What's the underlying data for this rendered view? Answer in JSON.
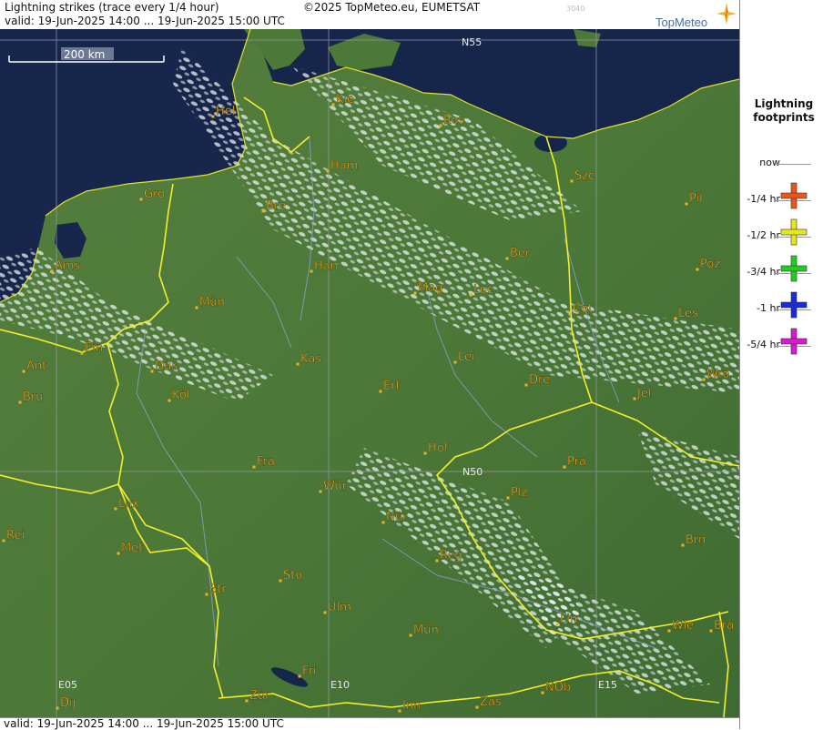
{
  "header": {
    "title": "Lightning strikes (trace every 1/4 hour)",
    "valid": "valid:  19-Jun-2025 14:00 ... 19-Jun-2025 15:00 UTC",
    "copyright": "©2025 TopMeteo.eu, EUMETSAT",
    "code": "3040",
    "logo": "TopMeteo"
  },
  "footer": {
    "valid": "valid:  19-Jun-2025 14:00 ... 19-Jun-2025 15:00 UTC"
  },
  "scale": {
    "label": "200 km"
  },
  "grid_labels": {
    "n55": "N55",
    "n50": "N50",
    "e05": "E05",
    "e10": "E10",
    "e15": "E15"
  },
  "cities": [
    {
      "name": "Hel"
    },
    {
      "name": "Kie"
    },
    {
      "name": "Ros"
    },
    {
      "name": "Ham"
    },
    {
      "name": "Szc"
    },
    {
      "name": "Gro"
    },
    {
      "name": "Bre"
    },
    {
      "name": "Pil"
    },
    {
      "name": "Ber"
    },
    {
      "name": "Ams"
    },
    {
      "name": "Han"
    },
    {
      "name": "Poz"
    },
    {
      "name": "Mün"
    },
    {
      "name": "Mag"
    },
    {
      "name": "Loc"
    },
    {
      "name": "Cot"
    },
    {
      "name": "Les"
    },
    {
      "name": "Ein"
    },
    {
      "name": "Kas"
    },
    {
      "name": "Lei"
    },
    {
      "name": "Ant"
    },
    {
      "name": "Düs"
    },
    {
      "name": "Dre"
    },
    {
      "name": "Wro"
    },
    {
      "name": "Bru"
    },
    {
      "name": "Köl"
    },
    {
      "name": "Erf"
    },
    {
      "name": "Jel"
    },
    {
      "name": "Hof"
    },
    {
      "name": "Fra"
    },
    {
      "name": "Pra"
    },
    {
      "name": "Wür"
    },
    {
      "name": "Plz"
    },
    {
      "name": "Lux"
    },
    {
      "name": "Nür"
    },
    {
      "name": "Rei"
    },
    {
      "name": "Met"
    },
    {
      "name": "Reg"
    },
    {
      "name": "Brn"
    },
    {
      "name": "Stu"
    },
    {
      "name": "Str"
    },
    {
      "name": "Ulm"
    },
    {
      "name": "Lin"
    },
    {
      "name": "Wie"
    },
    {
      "name": "Bra"
    },
    {
      "name": "Mün"
    },
    {
      "name": "Fri"
    },
    {
      "name": "NÖb"
    },
    {
      "name": "Dij"
    },
    {
      "name": "Zür"
    },
    {
      "name": "Inn"
    },
    {
      "name": "Zas"
    }
  ],
  "legend": {
    "title_line1": "Lightning",
    "title_line2": "footprints",
    "items": [
      {
        "label": "now",
        "color": ""
      },
      {
        "label": "-1/4 hr",
        "color": "#e8541c"
      },
      {
        "label": "-1/2 hr",
        "color": "#e6e61e"
      },
      {
        "label": "-3/4 hr",
        "color": "#22cc22"
      },
      {
        "label": "-1 hr",
        "color": "#1a2ad8"
      },
      {
        "label": "-5/4 hr",
        "color": "#d81ad0"
      }
    ]
  },
  "colors": {
    "land": "#4e7a3a",
    "sea": "#16264a",
    "border": "#f5ee2a",
    "city_label": "#f2b01e",
    "grid": "#9a9aa8"
  }
}
